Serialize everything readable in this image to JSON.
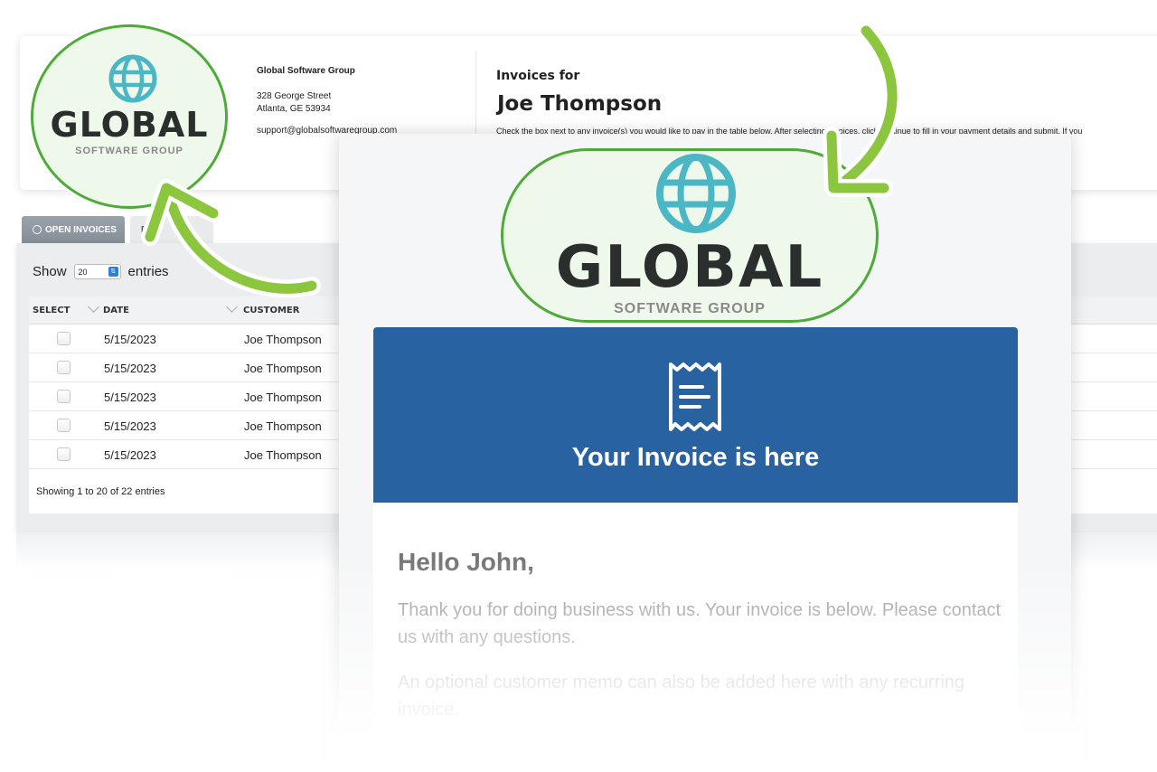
{
  "company": {
    "name": "Global Software Group",
    "address_line1": "328 George Street",
    "address_line2": "Atlanta, GE 53934",
    "email": "support@globalsoftwaregroup.com"
  },
  "header": {
    "invoices_for": "Invoices for",
    "customer_name": "Joe Thompson",
    "instruction": "Check the box next to any invoice(s) you would like to pay in the table below. After selecting invoices, click continue to fill in your payment details and submit. If you"
  },
  "logo": {
    "word": "GLOBAL",
    "subtitle": "SOFTWARE GROUP"
  },
  "tabs": [
    {
      "label": "OPEN INVOICES"
    },
    {
      "label": "P"
    }
  ],
  "entries": {
    "show_label": "Show",
    "value": "20",
    "suffix": "entries"
  },
  "table": {
    "columns": [
      "SELECT",
      "DATE",
      "CUSTOMER"
    ],
    "rows": [
      {
        "date": "5/15/2023",
        "customer": "Joe Thompson"
      },
      {
        "date": "5/15/2023",
        "customer": "Joe Thompson"
      },
      {
        "date": "5/15/2023",
        "customer": "Joe Thompson"
      },
      {
        "date": "5/15/2023",
        "customer": "Joe Thompson"
      },
      {
        "date": "5/15/2023",
        "customer": "Joe Thompson"
      }
    ],
    "footer": "Showing 1 to 20 of 22 entries"
  },
  "email": {
    "banner_title": "Your Invoice is here",
    "greeting": "Hello John,",
    "paragraph1": "Thank you for doing business with us. Your invoice is below. Please contact us with any questions.",
    "paragraph2": "An optional customer memo can also be added here with any recurring invoice."
  },
  "colors": {
    "banner_blue": "#2862a0",
    "logo_teal": "#4bb6c4",
    "highlight_green": "#4eab3a",
    "arrow_green": "#8cc63f"
  },
  "icons": [
    "globe-icon",
    "receipt-icon",
    "clock-icon",
    "chevron-down-icon",
    "arrow-icon"
  ]
}
